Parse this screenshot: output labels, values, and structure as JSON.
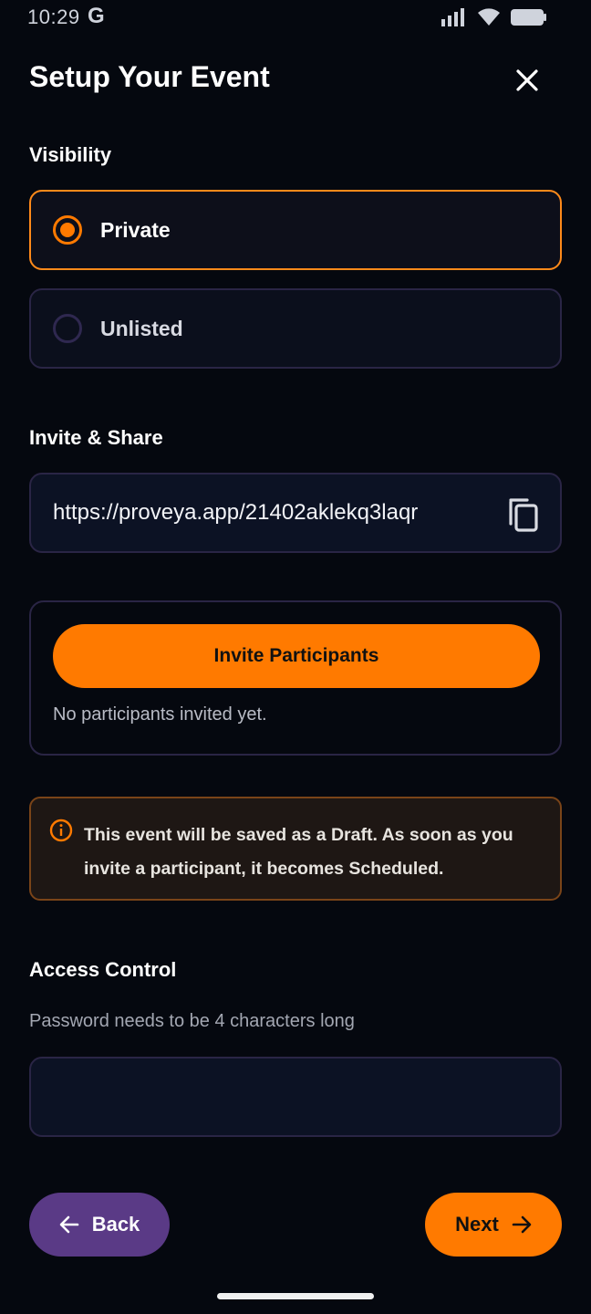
{
  "status_bar": {
    "time": "10:29",
    "google_glyph": "G",
    "icons": [
      "signal-icon",
      "wifi-icon",
      "battery-icon"
    ]
  },
  "header": {
    "title": "Setup Your Event",
    "close_icon": "close-icon"
  },
  "visibility": {
    "label": "Visibility",
    "options": [
      {
        "label": "Private",
        "selected": true
      },
      {
        "label": "Unlisted",
        "selected": false
      }
    ]
  },
  "invite_share": {
    "label": "Invite & Share",
    "link": "https://proveya.app/21402aklekq3laqr",
    "copy_icon": "copy-icon",
    "invite_button_label": "Invite Participants",
    "status_note": "No participants invited yet."
  },
  "draft_notice": {
    "icon": "info-icon",
    "text": "This event will be saved as a Draft. As soon as you invite a participant, it becomes Scheduled."
  },
  "access_control": {
    "label": "Access Control",
    "hint": "Password needs to be 4 characters long",
    "password_value": "",
    "password_placeholder": ""
  },
  "footer": {
    "back_label": "Back",
    "next_label": "Next"
  },
  "colors": {
    "accent": "#ff7a00",
    "back_button": "#5a3a86",
    "background": "#05080f",
    "draft_border": "#7a4418"
  }
}
